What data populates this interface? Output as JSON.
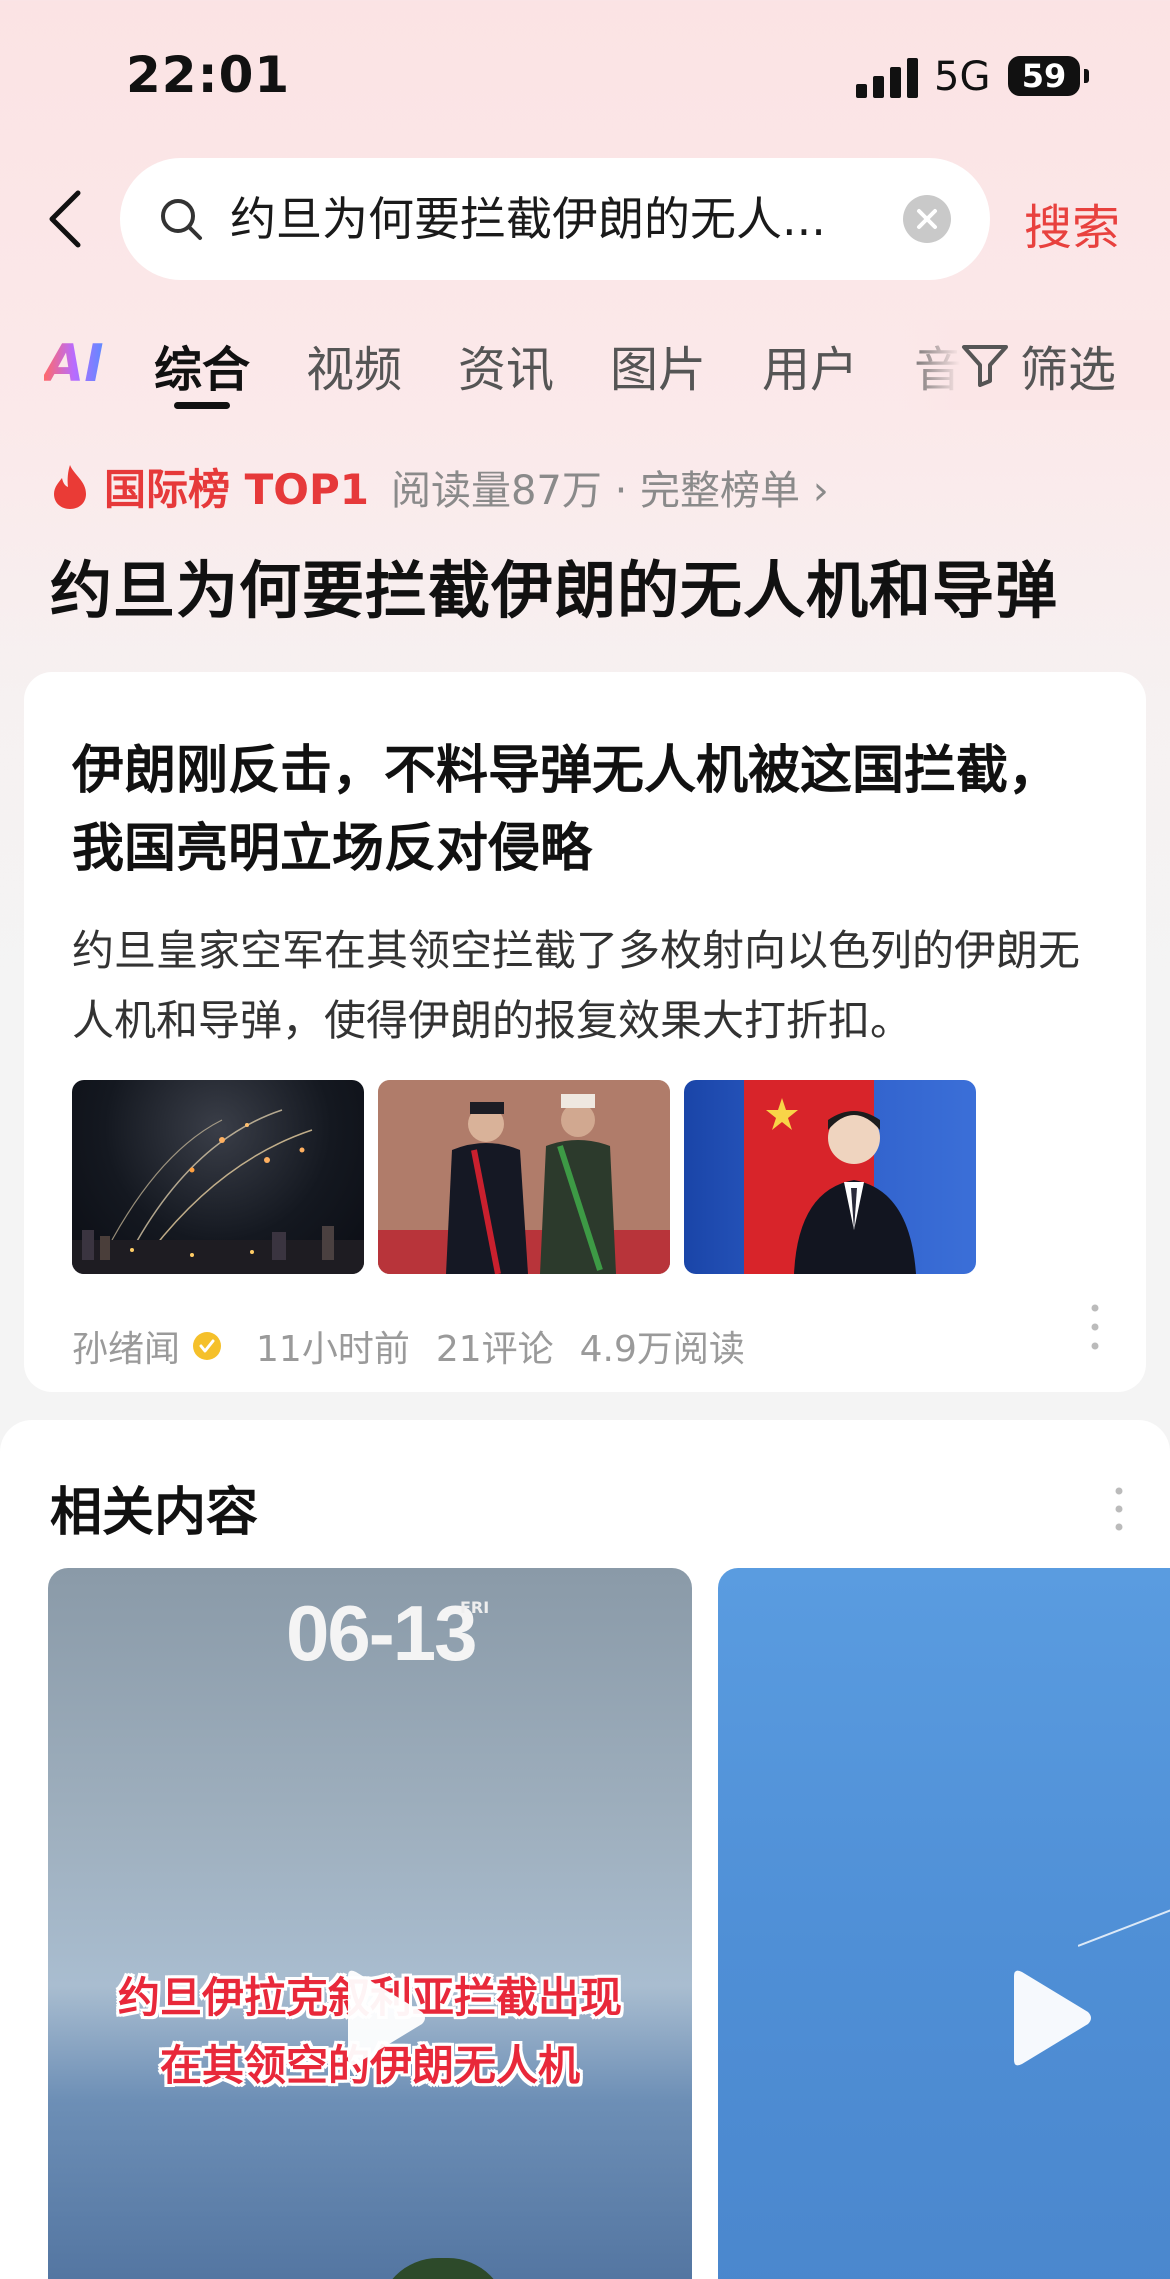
{
  "status_bar": {
    "time": "22:01",
    "network": "5G",
    "battery": "59"
  },
  "search": {
    "query": "约旦为何要拦截伊朗的无人...",
    "button_label": "搜索"
  },
  "tabs": {
    "ai_label": "AI",
    "items": [
      {
        "label": "综合",
        "active": true
      },
      {
        "label": "视频",
        "active": false
      },
      {
        "label": "资讯",
        "active": false
      },
      {
        "label": "图片",
        "active": false
      },
      {
        "label": "用户",
        "active": false
      },
      {
        "label": "音",
        "active": false
      }
    ],
    "filter_label": "筛选"
  },
  "hot_rank": {
    "label": "国际榜 TOP1",
    "meta": "阅读量87万 · 完整榜单 ›",
    "title": "约旦为何要拦截伊朗的无人机和导弹"
  },
  "article": {
    "title": "伊朗刚反击，不料导弹无人机被这国拦截，我国亮明立场反对侵略",
    "summary": "约旦皇家空军在其领空拦截了多枚射向以色列的伊朗无人机和导弹，使得伊朗的报复效果大打折扣。",
    "author": "孙绪闻",
    "time": "11小时前",
    "comments": "21评论",
    "reads": "4.9万阅读"
  },
  "related": {
    "title": "相关内容",
    "video1": {
      "date": "06-13",
      "day": "FRI",
      "caption_line1": "约旦伊拉克叙利亚拦截出现",
      "caption_line2": "在其领空的伊朗无人机"
    }
  },
  "colors": {
    "accent": "#e8413e",
    "rank_red": "#e6393a",
    "caption_red": "#e8283a"
  }
}
